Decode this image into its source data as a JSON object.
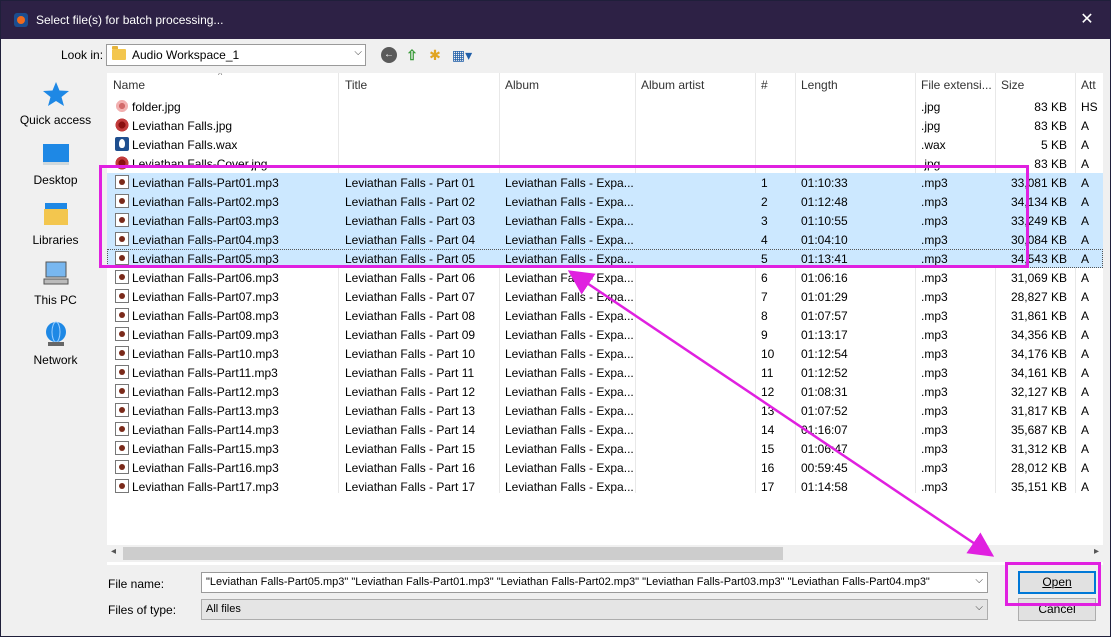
{
  "window": {
    "title": "Select file(s) for batch processing...",
    "close_glyph": "✕"
  },
  "toolbar": {
    "look_in_label": "Look in:",
    "look_in_value": "Audio Workspace_1"
  },
  "places": [
    {
      "label": "Quick access",
      "icon": "quick-access-icon"
    },
    {
      "label": "Desktop",
      "icon": "desktop-icon"
    },
    {
      "label": "Libraries",
      "icon": "libraries-icon"
    },
    {
      "label": "This PC",
      "icon": "this-pc-icon"
    },
    {
      "label": "Network",
      "icon": "network-icon"
    }
  ],
  "columns": [
    "Name",
    "Title",
    "Album",
    "Album artist",
    "#",
    "Length",
    "File extensi...",
    "Size",
    "Att"
  ],
  "files": [
    {
      "name": "folder.jpg",
      "title": "",
      "album": "",
      "track": "",
      "length": "",
      "ext": ".jpg",
      "size": "83 KB",
      "attr": "HS",
      "icon": "jpg-image-icon",
      "selected": false
    },
    {
      "name": "Leviathan Falls.jpg",
      "title": "",
      "album": "",
      "track": "",
      "length": "",
      "ext": ".jpg",
      "size": "83 KB",
      "attr": "A",
      "icon": "jpg-image-icon",
      "selected": false
    },
    {
      "name": "Leviathan Falls.wax",
      "title": "",
      "album": "",
      "track": "",
      "length": "",
      "ext": ".wax",
      "size": "5 KB",
      "attr": "A",
      "icon": "wax-file-icon",
      "selected": false
    },
    {
      "name": "Leviathan Falls-Cover.jpg",
      "title": "",
      "album": "",
      "track": "",
      "length": "",
      "ext": ".jpg",
      "size": "83 KB",
      "attr": "A",
      "icon": "jpg-image-icon",
      "selected": false
    },
    {
      "name": "Leviathan Falls-Part01.mp3",
      "title": "Leviathan Falls - Part 01",
      "album": "Leviathan Falls - Expa...",
      "track": "1",
      "length": "01:10:33",
      "ext": ".mp3",
      "size": "33,081 KB",
      "attr": "A",
      "icon": "mp3-file-icon",
      "selected": true
    },
    {
      "name": "Leviathan Falls-Part02.mp3",
      "title": "Leviathan Falls - Part 02",
      "album": "Leviathan Falls - Expa...",
      "track": "2",
      "length": "01:12:48",
      "ext": ".mp3",
      "size": "34,134 KB",
      "attr": "A",
      "icon": "mp3-file-icon",
      "selected": true
    },
    {
      "name": "Leviathan Falls-Part03.mp3",
      "title": "Leviathan Falls - Part 03",
      "album": "Leviathan Falls - Expa...",
      "track": "3",
      "length": "01:10:55",
      "ext": ".mp3",
      "size": "33,249 KB",
      "attr": "A",
      "icon": "mp3-file-icon",
      "selected": true
    },
    {
      "name": "Leviathan Falls-Part04.mp3",
      "title": "Leviathan Falls - Part 04",
      "album": "Leviathan Falls - Expa...",
      "track": "4",
      "length": "01:04:10",
      "ext": ".mp3",
      "size": "30,084 KB",
      "attr": "A",
      "icon": "mp3-file-icon",
      "selected": true
    },
    {
      "name": "Leviathan Falls-Part05.mp3",
      "title": "Leviathan Falls - Part 05",
      "album": "Leviathan Falls - Expa...",
      "track": "5",
      "length": "01:13:41",
      "ext": ".mp3",
      "size": "34,543 KB",
      "attr": "A",
      "icon": "mp3-file-icon",
      "selected": true,
      "focused": true
    },
    {
      "name": "Leviathan Falls-Part06.mp3",
      "title": "Leviathan Falls - Part 06",
      "album": "Leviathan Falls - Expa...",
      "track": "6",
      "length": "01:06:16",
      "ext": ".mp3",
      "size": "31,069 KB",
      "attr": "A",
      "icon": "mp3-file-icon",
      "selected": false
    },
    {
      "name": "Leviathan Falls-Part07.mp3",
      "title": "Leviathan Falls - Part 07",
      "album": "Leviathan Falls - Expa...",
      "track": "7",
      "length": "01:01:29",
      "ext": ".mp3",
      "size": "28,827 KB",
      "attr": "A",
      "icon": "mp3-file-icon",
      "selected": false
    },
    {
      "name": "Leviathan Falls-Part08.mp3",
      "title": "Leviathan Falls - Part 08",
      "album": "Leviathan Falls - Expa...",
      "track": "8",
      "length": "01:07:57",
      "ext": ".mp3",
      "size": "31,861 KB",
      "attr": "A",
      "icon": "mp3-file-icon",
      "selected": false
    },
    {
      "name": "Leviathan Falls-Part09.mp3",
      "title": "Leviathan Falls - Part 09",
      "album": "Leviathan Falls - Expa...",
      "track": "9",
      "length": "01:13:17",
      "ext": ".mp3",
      "size": "34,356 KB",
      "attr": "A",
      "icon": "mp3-file-icon",
      "selected": false
    },
    {
      "name": "Leviathan Falls-Part10.mp3",
      "title": "Leviathan Falls - Part 10",
      "album": "Leviathan Falls - Expa...",
      "track": "10",
      "length": "01:12:54",
      "ext": ".mp3",
      "size": "34,176 KB",
      "attr": "A",
      "icon": "mp3-file-icon",
      "selected": false
    },
    {
      "name": "Leviathan Falls-Part11.mp3",
      "title": "Leviathan Falls - Part 11",
      "album": "Leviathan Falls - Expa...",
      "track": "11",
      "length": "01:12:52",
      "ext": ".mp3",
      "size": "34,161 KB",
      "attr": "A",
      "icon": "mp3-file-icon",
      "selected": false
    },
    {
      "name": "Leviathan Falls-Part12.mp3",
      "title": "Leviathan Falls - Part 12",
      "album": "Leviathan Falls - Expa...",
      "track": "12",
      "length": "01:08:31",
      "ext": ".mp3",
      "size": "32,127 KB",
      "attr": "A",
      "icon": "mp3-file-icon",
      "selected": false
    },
    {
      "name": "Leviathan Falls-Part13.mp3",
      "title": "Leviathan Falls - Part 13",
      "album": "Leviathan Falls - Expa...",
      "track": "13",
      "length": "01:07:52",
      "ext": ".mp3",
      "size": "31,817 KB",
      "attr": "A",
      "icon": "mp3-file-icon",
      "selected": false
    },
    {
      "name": "Leviathan Falls-Part14.mp3",
      "title": "Leviathan Falls - Part 14",
      "album": "Leviathan Falls - Expa...",
      "track": "14",
      "length": "01:16:07",
      "ext": ".mp3",
      "size": "35,687 KB",
      "attr": "A",
      "icon": "mp3-file-icon",
      "selected": false
    },
    {
      "name": "Leviathan Falls-Part15.mp3",
      "title": "Leviathan Falls - Part 15",
      "album": "Leviathan Falls - Expa...",
      "track": "15",
      "length": "01:06:47",
      "ext": ".mp3",
      "size": "31,312 KB",
      "attr": "A",
      "icon": "mp3-file-icon",
      "selected": false
    },
    {
      "name": "Leviathan Falls-Part16.mp3",
      "title": "Leviathan Falls - Part 16",
      "album": "Leviathan Falls - Expa...",
      "track": "16",
      "length": "00:59:45",
      "ext": ".mp3",
      "size": "28,012 KB",
      "attr": "A",
      "icon": "mp3-file-icon",
      "selected": false
    },
    {
      "name": "Leviathan Falls-Part17.mp3",
      "title": "Leviathan Falls - Part 17",
      "album": "Leviathan Falls - Expa...",
      "track": "17",
      "length": "01:14:58",
      "ext": ".mp3",
      "size": "35,151 KB",
      "attr": "A",
      "icon": "mp3-file-icon",
      "selected": false
    }
  ],
  "footer": {
    "file_name_label": "File name:",
    "file_name_value": "\"Leviathan Falls-Part05.mp3\" \"Leviathan Falls-Part01.mp3\" \"Leviathan Falls-Part02.mp3\" \"Leviathan Falls-Part03.mp3\" \"Leviathan Falls-Part04.mp3\"",
    "files_of_type_label": "Files of type:",
    "files_of_type_value": "All files",
    "open_label": "Open",
    "cancel_label": "Cancel"
  },
  "colors": {
    "titlebar": "#2d2145",
    "selection": "#cce8ff",
    "annotation": "#e020e0"
  }
}
